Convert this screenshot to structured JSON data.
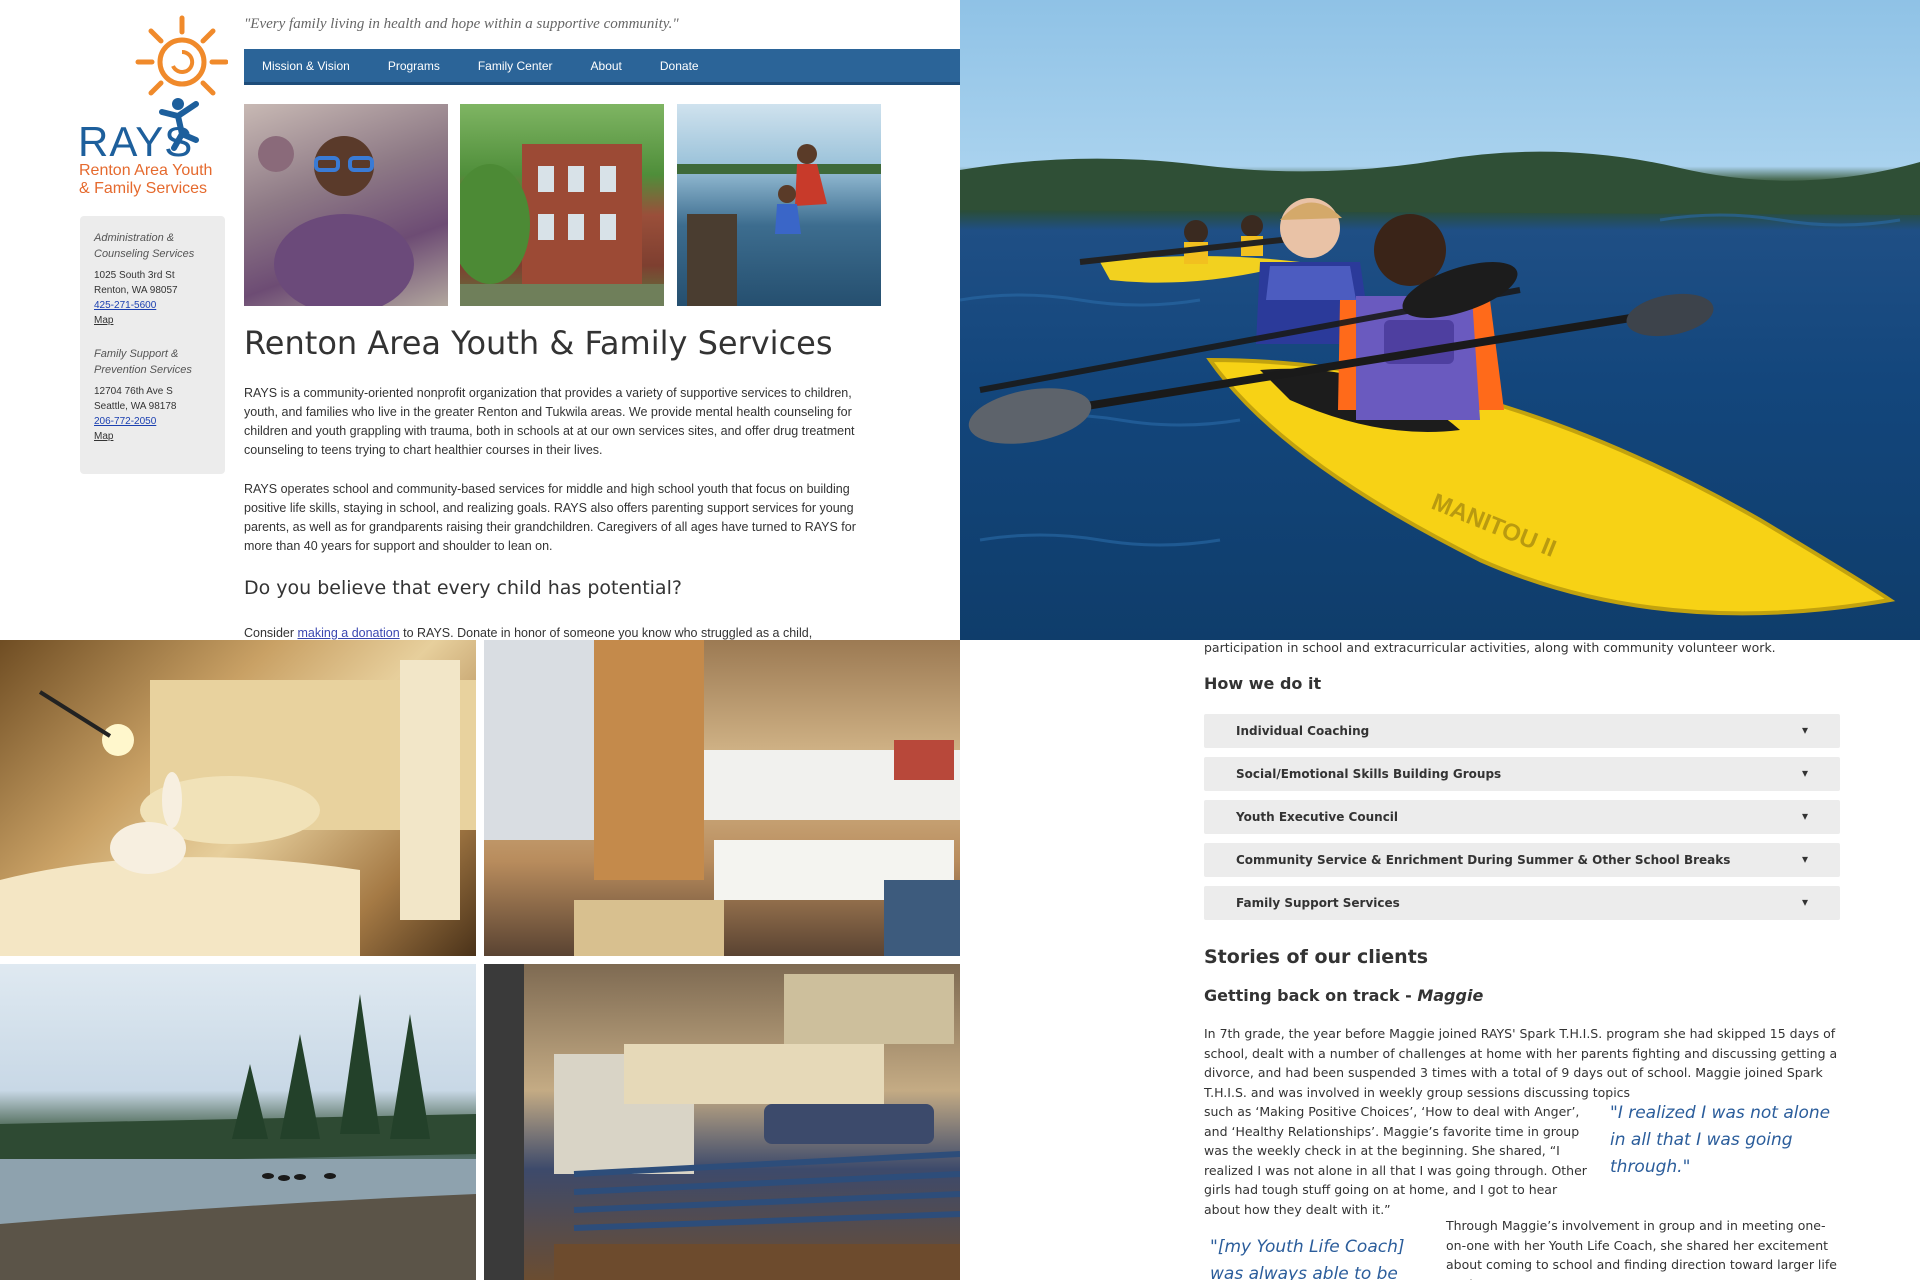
{
  "site": {
    "logo": {
      "title": "RAYS",
      "subtitle_line1": "Renton Area Youth",
      "subtitle_line2": "& Family Services"
    },
    "tagline": "\"Every family living in health and hope within a supportive community.\"",
    "nav": [
      "Mission & Vision",
      "Programs",
      "Family Center",
      "About",
      "Donate"
    ],
    "addresses": [
      {
        "heading": "Administration & Counseling Services",
        "street": "1025 South 3rd St",
        "city": "Renton, WA 98057",
        "phone": "425-271-5600",
        "map": "Map"
      },
      {
        "heading": "Family Support & Prevention Services",
        "street": "12704 76th Ave S",
        "city": "Seattle, WA 98178",
        "phone": "206-772-2050",
        "map": "Map"
      }
    ],
    "heading": "Renton Area Youth & Family Services",
    "para1": "RAYS is a community-oriented nonprofit organization that provides a variety of supportive services to children, youth, and families who live in the greater Renton and Tukwila areas. We provide mental health counseling for children and youth grappling with trauma, both in schools at at our own services sites, and offer drug treatment counseling to teens trying to chart healthier courses in their lives.",
    "para2": "RAYS operates school and community-based services for middle and high school youth that focus on building positive life skills, staying in school, and realizing goals. RAYS also offers parenting support services for young parents, as well as for grandparents raising their grandchildren. Caregivers of all ages have turned to RAYS for more than 40 years for support and shoulder to lean on.",
    "subheading": "Do you believe that every child has potential?",
    "para3_before": "Consider ",
    "para3_link": "making a donation",
    "para3_after": " to RAYS. Donate in honor of someone you know who struggled as a child,"
  },
  "kayak": {
    "boat_label": "MANITOU II"
  },
  "program": {
    "intro_cut": "participation in school and extracurricular activities, along with community volunteer work.",
    "how_heading": "How we do it",
    "accordion": [
      "Individual Coaching",
      "Social/Emotional Skills Building Groups",
      "Youth Executive Council",
      "Community Service & Enrichment During Summer & Other School Breaks",
      "Family Support Services"
    ],
    "stories_heading": "Stories of our clients",
    "story_title": "Getting back on track - ",
    "story_name": "Maggie",
    "story_para1": "In 7th grade, the year before Maggie joined RAYS' Spark T.H.I.S. program she had skipped 15 days of school, dealt with a number of challenges at home with her parents fighting and discussing getting a divorce, and had been suspended 3 times with a total of 9 days out of school. Maggie joined Spark T.H.I.S. and was involved in weekly group sessions discussing topics",
    "story_para1_cont": "such as ‘Making Positive Choices’, ‘How to deal with Anger’, and ‘Healthy Relationships’. Maggie’s favorite time in group was the weekly check in at the beginning. She shared, “I realized I was not alone in all that I was going through. Other girls had tough stuff going on at home, and I got to hear about how they dealt with it.”",
    "quote1": "\"I realized I was not alone in all that I was going through.\"",
    "quote2": "\"[my Youth Life Coach] was always able to be there &",
    "story_para2": "Through Maggie’s involvement in group and in meeting one-on-one with her Youth Life Coach, she shared her excitement about coming to school and finding direction toward larger life goals. “I"
  }
}
